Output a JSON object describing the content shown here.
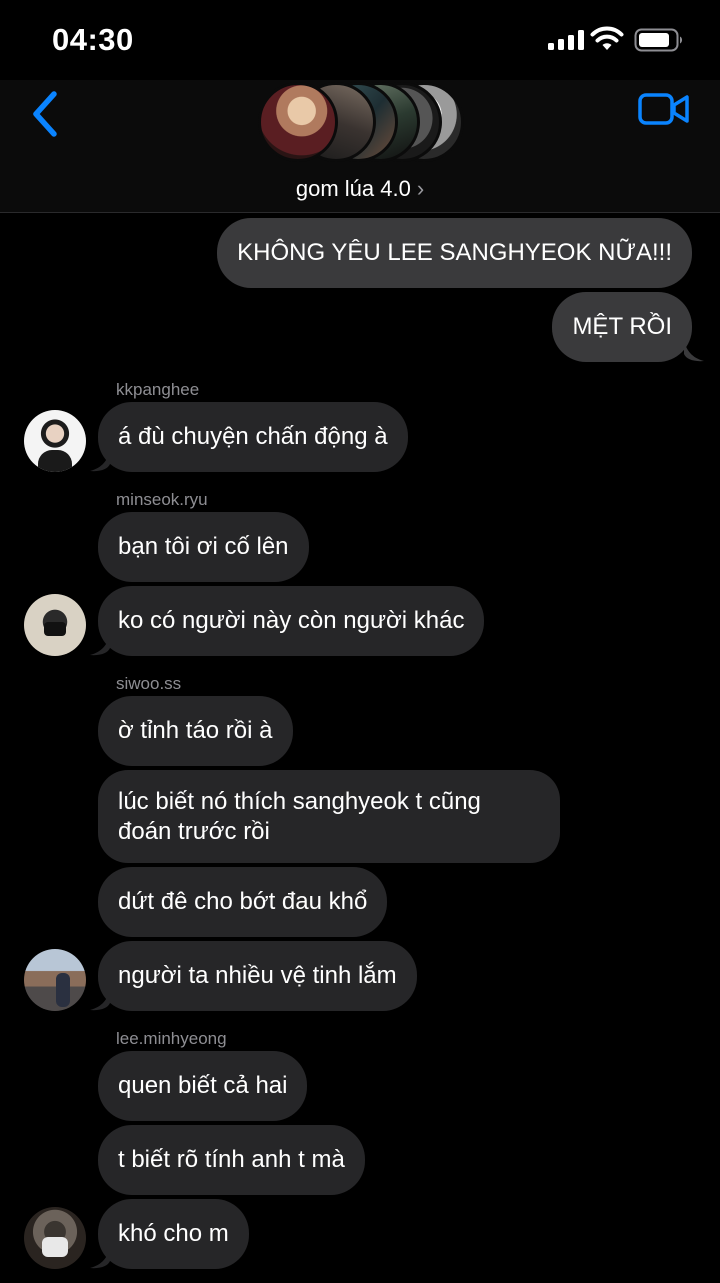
{
  "status_bar": {
    "time": "04:30"
  },
  "header": {
    "group_name": "gom lúa 4.0",
    "chevron": "›",
    "accent_color": "#0a84ff",
    "icons": [
      "back-chevron-icon",
      "video-camera-icon"
    ]
  },
  "messages": [
    {
      "direction": "outgoing",
      "text": "KHÔNG YÊU LEE SANGHYEOK NỮA!!!"
    },
    {
      "direction": "outgoing",
      "text": "MỆT RỒI"
    },
    {
      "direction": "incoming",
      "sender": "kkpanghee",
      "text": "á đù chuyện chấn động à"
    },
    {
      "direction": "incoming",
      "sender": "minseok.ryu",
      "text": "bạn tôi ơi cố lên"
    },
    {
      "direction": "incoming",
      "text": "ko có người này còn người khác"
    },
    {
      "direction": "incoming",
      "sender": "siwoo.ss",
      "text": "ờ tỉnh táo rồi à"
    },
    {
      "direction": "incoming",
      "text": "lúc biết nó thích sanghyeok t cũng đoán trước rồi"
    },
    {
      "direction": "incoming",
      "text": "dứt đê cho bớt đau khổ"
    },
    {
      "direction": "incoming",
      "text": "người ta nhiều vệ tinh lắm"
    },
    {
      "direction": "incoming",
      "sender": "lee.minhyeong",
      "text": "quen biết cả hai"
    },
    {
      "direction": "incoming",
      "text": "t biết rõ tính anh t mà"
    },
    {
      "direction": "incoming",
      "text": "khó cho m"
    }
  ],
  "colors": {
    "background": "#000000",
    "incoming_bubble": "#262628",
    "outgoing_bubble": "#3a3a3c",
    "sender_label": "#8e8e93"
  }
}
